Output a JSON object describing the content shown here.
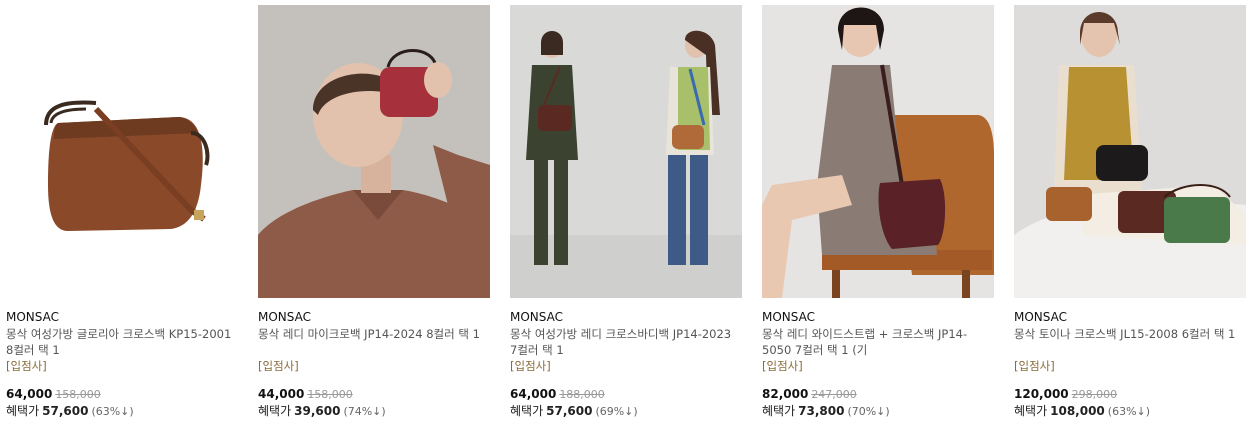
{
  "products": [
    {
      "brand": "MONSAC",
      "title": "몽삭 여성가방 글로리아 크로스백 KP15-2001 8컬러 택 1",
      "tag": "[입점사]",
      "price": "64,000",
      "original_price": "158,000",
      "benefit_label": "혜택가",
      "benefit_price": "57,600",
      "benefit_rate": "(63%↓)",
      "image": "brown-crossbody-bag-product-photo"
    },
    {
      "brand": "MONSAC",
      "title": "몽삭 레디 마이크로백 JP14-2024 8컬러 택 1",
      "tag": "[입점사]",
      "price": "44,000",
      "original_price": "158,000",
      "benefit_label": "혜택가",
      "benefit_price": "39,600",
      "benefit_rate": "(74%↓)",
      "image": "model-holding-red-micro-bag-photo"
    },
    {
      "brand": "MONSAC",
      "title": "몽삭 여성가방 레디 크로스바디백 JP14-2023 7컬러 택 1",
      "tag": "[입점사]",
      "price": "64,000",
      "original_price": "188,000",
      "benefit_label": "혜택가",
      "benefit_price": "57,600",
      "benefit_rate": "(69%↓)",
      "image": "two-models-with-crossbody-bags-photo"
    },
    {
      "brand": "MONSAC",
      "title": "몽삭 레디 와이드스트랩 + 크로스백 JP14-5050 7컬러 택 1 (기",
      "tag": "[입점사]",
      "price": "82,000",
      "original_price": "247,000",
      "benefit_label": "혜택가",
      "benefit_price": "73,800",
      "benefit_rate": "(70%↓)",
      "image": "seated-model-with-burgundy-bag-photo"
    },
    {
      "brand": "MONSAC",
      "title": "몽삭 토이나 크로스백 JL15-2008 6컬러 택 1",
      "tag": "[입점사]",
      "price": "120,000",
      "original_price": "298,000",
      "benefit_label": "혜택가",
      "benefit_price": "108,000",
      "benefit_rate": "(63%↓)",
      "image": "seated-model-with-multiple-bags-photo"
    }
  ]
}
